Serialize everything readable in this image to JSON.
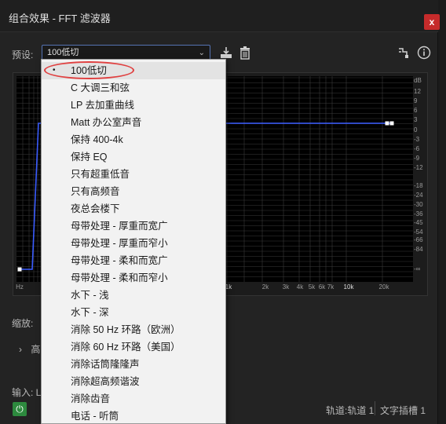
{
  "window": {
    "title": "组合效果 - FFT 滤波器",
    "close_label": "x"
  },
  "preset": {
    "label": "预设:",
    "value": "100低切"
  },
  "icons": {
    "save": "save-preset-icon",
    "delete": "trash-icon",
    "routing": "routing-icon",
    "info": "info-icon",
    "power": "power-icon"
  },
  "graph": {
    "db_unit": "dB",
    "db_ticks": [
      "12",
      "9",
      "6",
      "3",
      "0",
      "-3",
      "-6",
      "-9",
      "-12",
      "-18",
      "-24",
      "-30",
      "-36",
      "-45",
      "-54",
      "-66",
      "-84",
      "-∞"
    ],
    "hz_unit": "Hz",
    "hz_ticks": [
      "1k",
      "2k",
      "3k",
      "4k",
      "5k",
      "6k",
      "7k",
      "10k",
      "20k"
    ],
    "curve_color": "#3a5cff"
  },
  "zoom": {
    "label": "缩放:"
  },
  "advanced": {
    "chevron": "›",
    "label": "高"
  },
  "input": {
    "label": "输入: L"
  },
  "status": {
    "track": "轨道:轨道 1",
    "text": "文字插槽 1"
  },
  "dropdown": {
    "selected_bullet": "•",
    "items": [
      "100低切",
      "C 大调三和弦",
      "LP 去加重曲线",
      "Matt 办公室声音",
      "保持 400-4k",
      "保持 EQ",
      "只有超重低音",
      "只有高频音",
      "夜总会楼下",
      "母带处理 - 厚重而宽广",
      "母带处理 - 厚重而窄小",
      "母带处理 - 柔和而宽广",
      "母带处理 - 柔和而窄小",
      "水下 - 浅",
      "水下 - 深",
      "消除 50 Hz 环路（欧洲）",
      "消除 60 Hz 环路（美国）",
      "消除话筒隆隆声",
      "消除超高频谐波",
      "消除齿音",
      "电话 - 听筒"
    ]
  }
}
